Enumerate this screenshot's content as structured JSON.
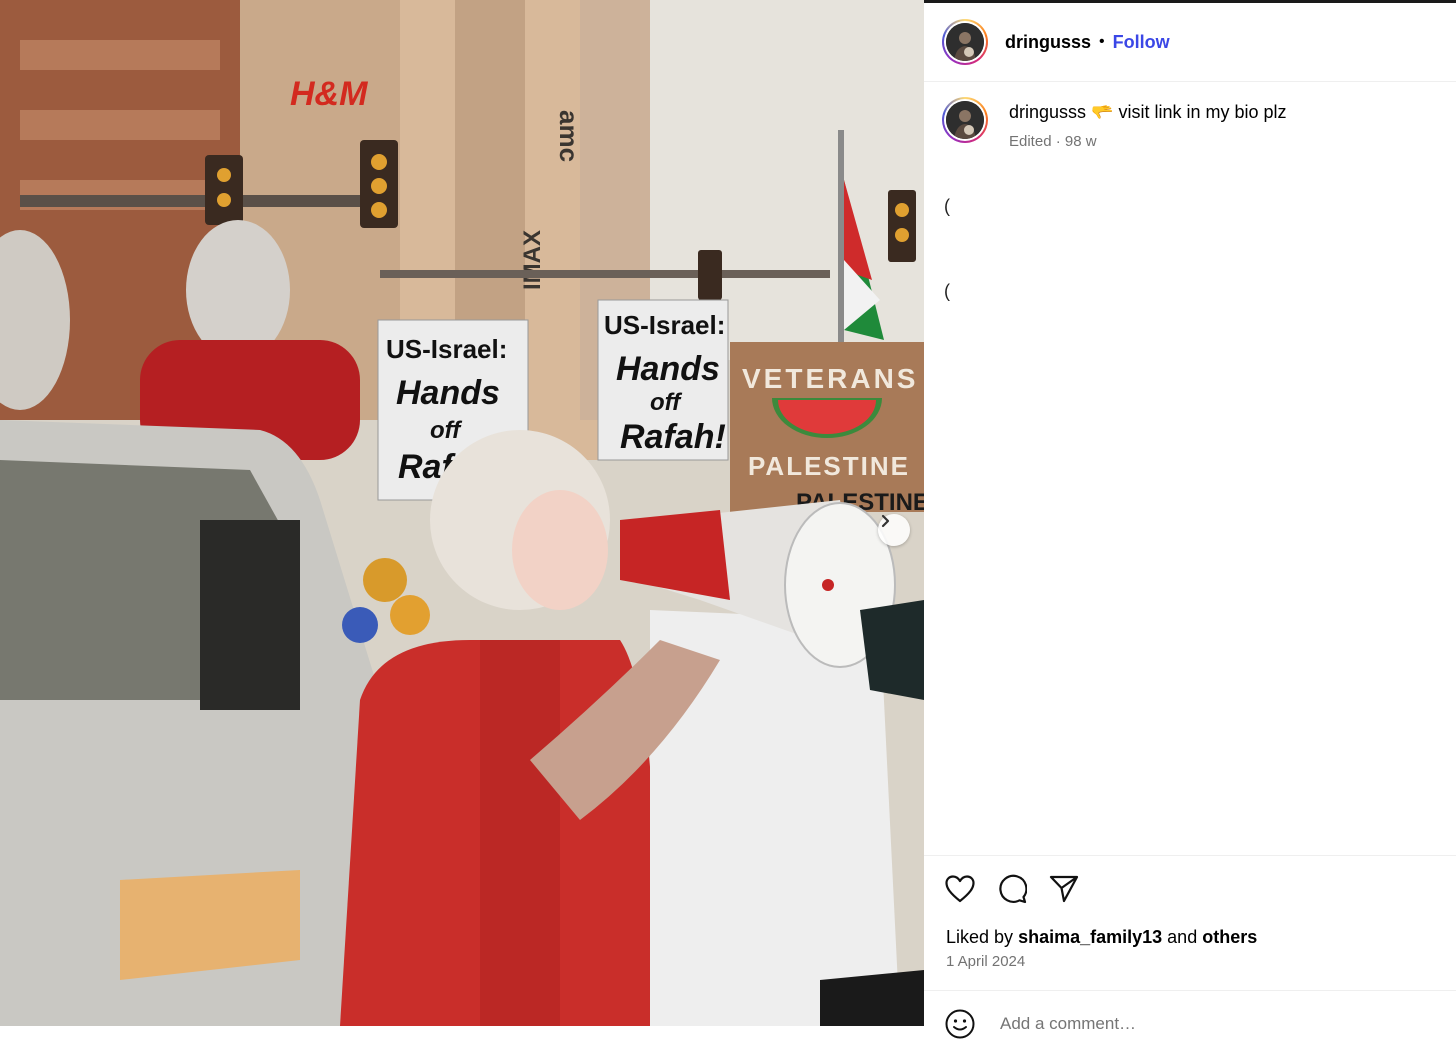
{
  "post": {
    "username": "dringusss",
    "follow_label": "Follow",
    "separator": "•"
  },
  "caption": {
    "username": "dringusss",
    "emoji": "🫳",
    "text": "visit link in my bio plz",
    "meta": "Edited · 98 w",
    "glyph_1": "(",
    "glyph_2": "("
  },
  "photo": {
    "signs": {
      "sign_a_line1": "US-Israel:",
      "sign_a_line2": "Hands",
      "sign_a_line3": "off",
      "sign_a_line4": "Rafah",
      "sign_b_line1": "US-Israel:",
      "sign_b_line2": "Hands",
      "sign_b_line3": "off",
      "sign_b_line4": "Rafah!",
      "veterans": "VETERANS",
      "palestine": "PALESTINE",
      "palestine2": "PALESTINE",
      "imax": "IMAX",
      "amc": "amc",
      "hm": "H&M"
    }
  },
  "likes": {
    "prefix": "Liked by",
    "user": "shaima_family13",
    "joiner": "and",
    "others": "others"
  },
  "date": "1 April 2024",
  "comment": {
    "placeholder": "Add a comment…"
  },
  "icons": {
    "like": "heart-icon",
    "comment": "comment-icon",
    "share": "share-icon",
    "next": "chevron-right-icon",
    "emoji": "emoji-icon"
  }
}
